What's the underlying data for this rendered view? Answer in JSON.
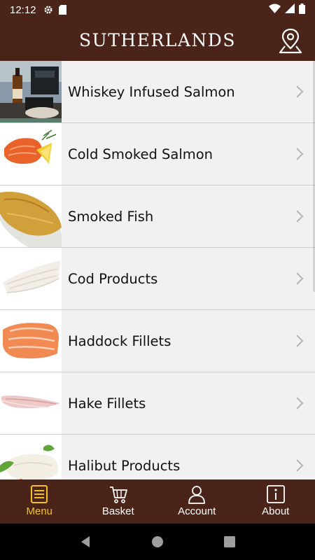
{
  "status_bar": {
    "time": "12:12",
    "icons": [
      "gear-icon",
      "sd-card-icon",
      "wifi-icon",
      "signal-icon",
      "battery-icon"
    ]
  },
  "header": {
    "title": "SUTHERLANDS",
    "location_icon": "map-pin-icon"
  },
  "categories": [
    {
      "label": "Whiskey Infused Salmon",
      "thumb": "whiskey-salmon-photo"
    },
    {
      "label": "Cold Smoked Salmon",
      "thumb": "cold-smoked-salmon-photo"
    },
    {
      "label": "Smoked Fish",
      "thumb": "smoked-fish-photo"
    },
    {
      "label": "Cod Products",
      "thumb": "cod-photo"
    },
    {
      "label": "Haddock Fillets",
      "thumb": "haddock-photo"
    },
    {
      "label": "Hake Fillets",
      "thumb": "hake-photo"
    },
    {
      "label": "Halibut Products",
      "thumb": "halibut-photo"
    }
  ],
  "bottom_nav": {
    "menu": "Menu",
    "basket": "Basket",
    "account": "Account",
    "about": "About",
    "active": "menu"
  },
  "colors": {
    "brand_brown": "#4a2418",
    "active_yellow": "#f2c21a",
    "list_bg": "#f1f1f1"
  }
}
